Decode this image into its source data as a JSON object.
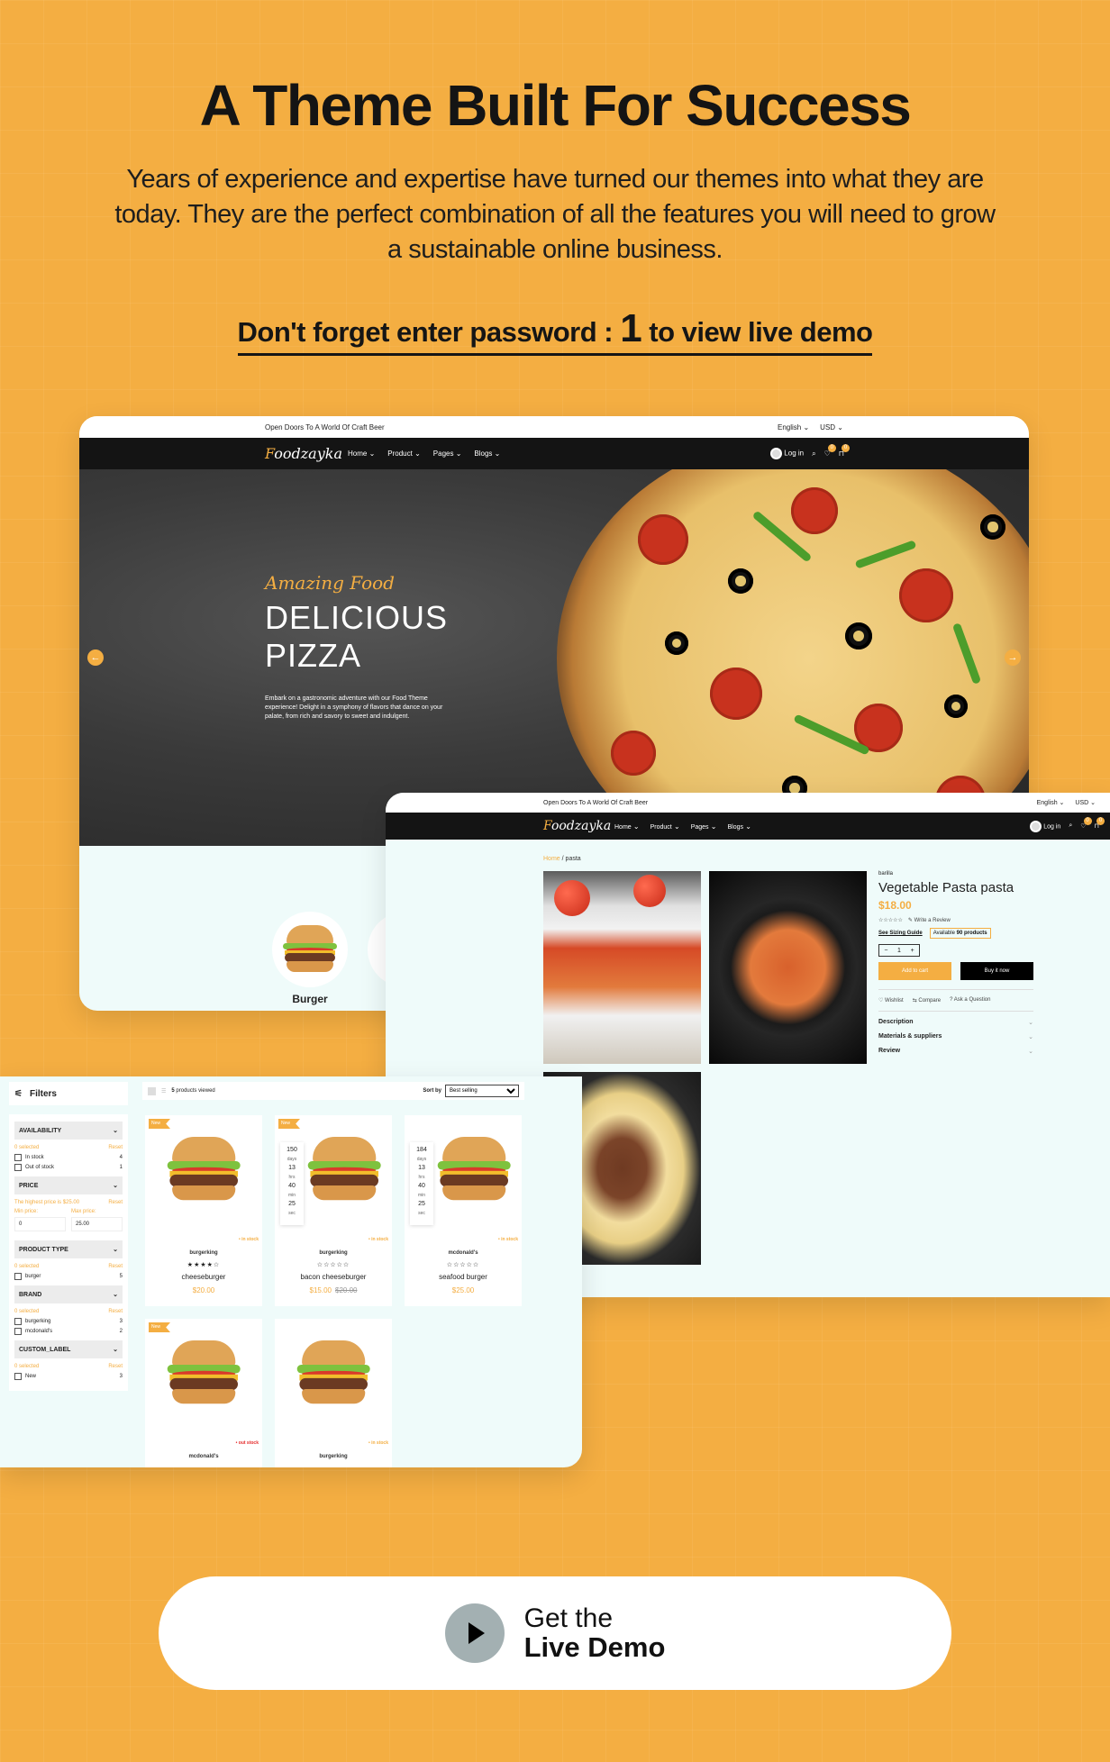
{
  "hero": {
    "title": "A Theme Built For Success",
    "subtitle": "Years of experience and expertise have turned our themes into what they are today. They are the perfect combination of all the features you will need to grow a sustainable online business.",
    "password_prefix": "Don't forget enter password : ",
    "password_value": "1",
    "password_suffix": " to view live demo"
  },
  "store": {
    "announcement": "Open Doors To A World Of Craft Beer",
    "language": "English ⌄",
    "currency": "USD ⌄",
    "logo_first": "F",
    "logo_rest": "oodzayka",
    "menu": [
      "Home",
      "Product",
      "Pages",
      "Blogs"
    ],
    "login": "Log in",
    "wishlist_count": "0",
    "cart_count": "0",
    "colors": {
      "accent": "#f4ae42",
      "nav": "#141414",
      "page_bg": "#effbfa"
    }
  },
  "homepage": {
    "kicker": "Amazing Food",
    "title_line1": "DELICIOUS",
    "title_line2": "PIZZA",
    "description": "Embark on a gastronomic adventure with our Food Theme experience! Delight in a symphony of flavors that dance on your palate, from rich and savory to sweet and indulgent.",
    "prev_arrow": "←",
    "next_arrow": "→",
    "category": "Burger"
  },
  "product_page": {
    "breadcrumb_home": "Home",
    "breadcrumb_sep": "/",
    "breadcrumb_current": "pasta",
    "brand": "barilla",
    "name": "Vegetable Pasta pasta",
    "price": "$18.00",
    "stars": "☆☆☆☆☆",
    "write_review": "✎ Write a Review",
    "sizing_guide": "See Sizing Guide",
    "availability_prefix": "Available ",
    "availability_value": "90 products",
    "qty_minus": "−",
    "qty_value": "1",
    "qty_plus": "+",
    "add_to_cart": "Add to cart",
    "buy_now": "Buy it now",
    "wishlist": "♡ Wishlist",
    "compare": "⇆ Compare",
    "ask": "? Ask a Question",
    "accordions": [
      "Description",
      "Materials & suppliers",
      "Review"
    ]
  },
  "collection": {
    "filters_title": "Filters",
    "filter_groups": [
      {
        "title": "AVAILABILITY",
        "meta_left": "0 selected",
        "meta_right": "Reset",
        "options": [
          {
            "label": "In stock",
            "count": "4"
          },
          {
            "label": "Out of stock",
            "count": "1"
          }
        ]
      },
      {
        "title": "PRICE",
        "meta_left": "The highest price is $25.00",
        "meta_right": "Reset",
        "min_label": "Min price:",
        "max_label": "Max price:",
        "min_value": "0",
        "max_value": "25.00"
      },
      {
        "title": "PRODUCT TYPE",
        "meta_left": "0 selected",
        "meta_right": "Reset",
        "options": [
          {
            "label": "burger",
            "count": "5"
          }
        ]
      },
      {
        "title": "BRAND",
        "meta_left": "0 selected",
        "meta_right": "Reset",
        "options": [
          {
            "label": "burgerking",
            "count": "3"
          },
          {
            "label": "mcdonald's",
            "count": "2"
          }
        ]
      },
      {
        "title": "CUSTOM_LABEL",
        "meta_left": "0 selected",
        "meta_right": "Reset",
        "options": [
          {
            "label": "New",
            "count": "3"
          }
        ]
      }
    ],
    "products_count": "5",
    "products_label": " products viewed",
    "sort_label": "Sort by",
    "sort_value": "Best selling",
    "products": [
      {
        "tag": "New",
        "brand": "burgerking",
        "stars": "★★★★☆",
        "name": "cheeseburger",
        "price": "$20.00",
        "compare_price": "",
        "stock": "• in stock"
      },
      {
        "tag": "New",
        "brand": "burgerking",
        "stars": "☆☆☆☆☆",
        "name": "bacon cheeseburger",
        "price": "$15.00",
        "compare_price": "$20.00",
        "stock": "• in stock",
        "countdown": {
          "days": "150",
          "hrs": "13",
          "min": "40",
          "sec": "25"
        }
      },
      {
        "tag": "",
        "brand": "mcdonald's",
        "stars": "☆☆☆☆☆",
        "name": "seafood burger",
        "price": "$25.00",
        "compare_price": "",
        "stock": "• in stock",
        "countdown": {
          "days": "184",
          "hrs": "13",
          "min": "40",
          "sec": "25"
        }
      },
      {
        "tag": "New",
        "brand": "mcdonald's",
        "stars": "",
        "name": "",
        "price": "",
        "compare_price": "",
        "stock": "• out stock"
      },
      {
        "tag": "",
        "brand": "burgerking",
        "stars": "",
        "name": "",
        "price": "",
        "compare_price": "",
        "stock": "• in stock"
      }
    ],
    "countdown_units": {
      "days": "days",
      "hrs": "hrs",
      "min": "min",
      "sec": "sec"
    }
  },
  "cta": {
    "line1": "Get the",
    "line2": "Live Demo"
  }
}
